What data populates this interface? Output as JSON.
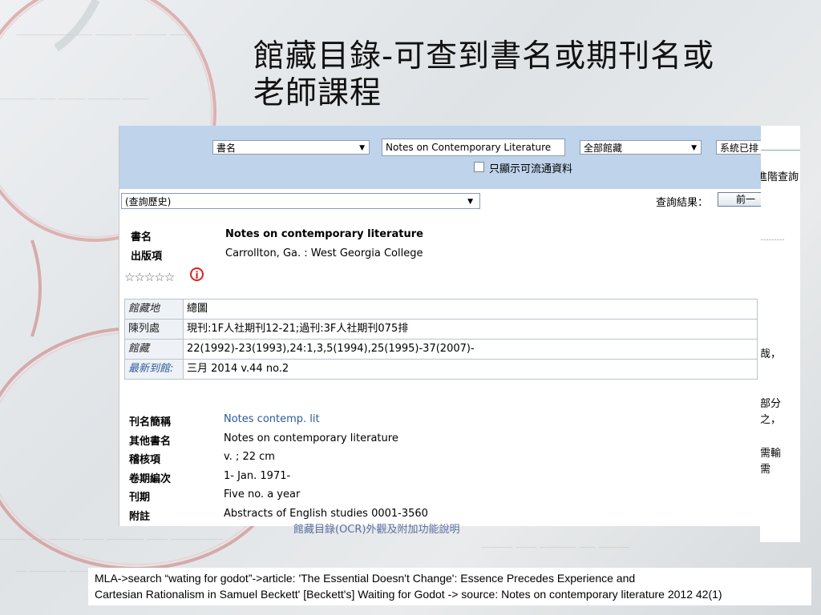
{
  "slide": {
    "title_line1": "館藏目錄-可查到書名或期刊名或",
    "title_line2": "老師課程"
  },
  "search": {
    "field_select": "書名",
    "query_value": "Notes on Contemporary Literature",
    "scope_select": "全部館藏",
    "system_select": "系統已排",
    "advanced_link": "進階查詢",
    "available_only_label": "只顯示可流通資料",
    "history_select": "(查詢歷史)",
    "results_label": "查詢結果：",
    "prev_button": "前一"
  },
  "record": {
    "title_label": "書名",
    "title_value": "Notes on contemporary literature",
    "publisher_label": "出版項",
    "publisher_value": "Carrollton, Ga. : West Georgia College",
    "stars": "☆☆☆☆☆",
    "info_icon": "i"
  },
  "holdings": [
    {
      "label": "館藏地",
      "value": "總圖"
    },
    {
      "label": "陳列處",
      "value": "現刊:1F人社期刊12-21;過刊:3F人社期刊075排"
    },
    {
      "label": "館藏",
      "value": "22(1992)-23(1993),24:1,3,5(1994),25(1995)-37(2007)-"
    },
    {
      "label": "最新到館:",
      "value": "三月 2014 v.44 no.2"
    }
  ],
  "metadata": [
    {
      "label": "刊名簡稱",
      "value": "Notes contemp. lit",
      "link": true
    },
    {
      "label": "其他書名",
      "value": "Notes on contemporary literature",
      "link": false
    },
    {
      "label": "稽核項",
      "value": "v. ; 22 cm",
      "link": false
    },
    {
      "label": "卷期編次",
      "value": "1- Jan. 1971-",
      "link": false
    },
    {
      "label": "刊期",
      "value": "Five no. a year",
      "link": false
    },
    {
      "label": "附註",
      "value": "Abstracts of English studies 0001-3560",
      "link": false
    }
  ],
  "right_fragments": [
    "哉，",
    "部分",
    "之，",
    "需輸",
    "需"
  ],
  "under_text": "館藏目錄(OCR)外觀及附加功能說明",
  "note_line1": "MLA->search “wating for godot”->article: 'The Essential Doesn't Change': Essence Precedes Experience and",
  "note_line2": "Cartesian Rationalism in Samuel Beckett' [Beckett's] Waiting for Godot -> source: Notes on contemporary literature 2012 42(1)",
  "colors": {
    "toolbar_bg": "#bfd3ea",
    "link": "#2c5a9c",
    "info_red": "#e02020"
  }
}
